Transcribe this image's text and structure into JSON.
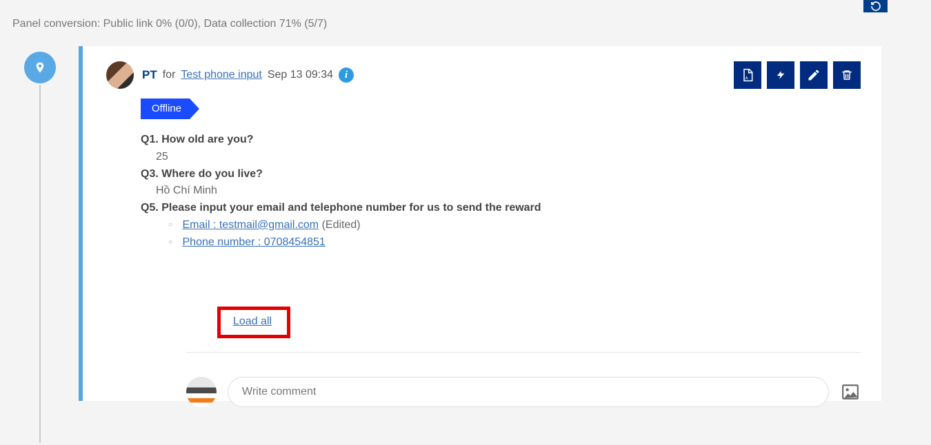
{
  "top": {
    "conversion_text": "Panel conversion: Public link 0% (0/0), Data collection 71% (5/7)"
  },
  "card": {
    "user": "PT",
    "for_label": "for",
    "project_link": "Test phone input",
    "timestamp": "Sep 13 09:34",
    "info_glyph": "i",
    "status": "Offline",
    "q1": "Q1. How old are you?",
    "a1": "25",
    "q3": "Q3. Where do you live?",
    "a3": "Hồ Chí Minh",
    "q5": "Q5. Please input your email and telephone number for us to send the reward",
    "email_line": "Email : testmail@gmail.com",
    "edited": "(Edited)",
    "phone_line": "Phone number : 0708454851",
    "load_all": "Load all"
  },
  "comment": {
    "placeholder": "Write comment"
  },
  "icons": {
    "pin": "pin-icon",
    "pdf": "pdf-icon",
    "bolt": "lightning-icon",
    "edit": "pencil-icon",
    "trash": "trash-icon",
    "image": "image-icon",
    "refresh": "refresh-icon"
  }
}
